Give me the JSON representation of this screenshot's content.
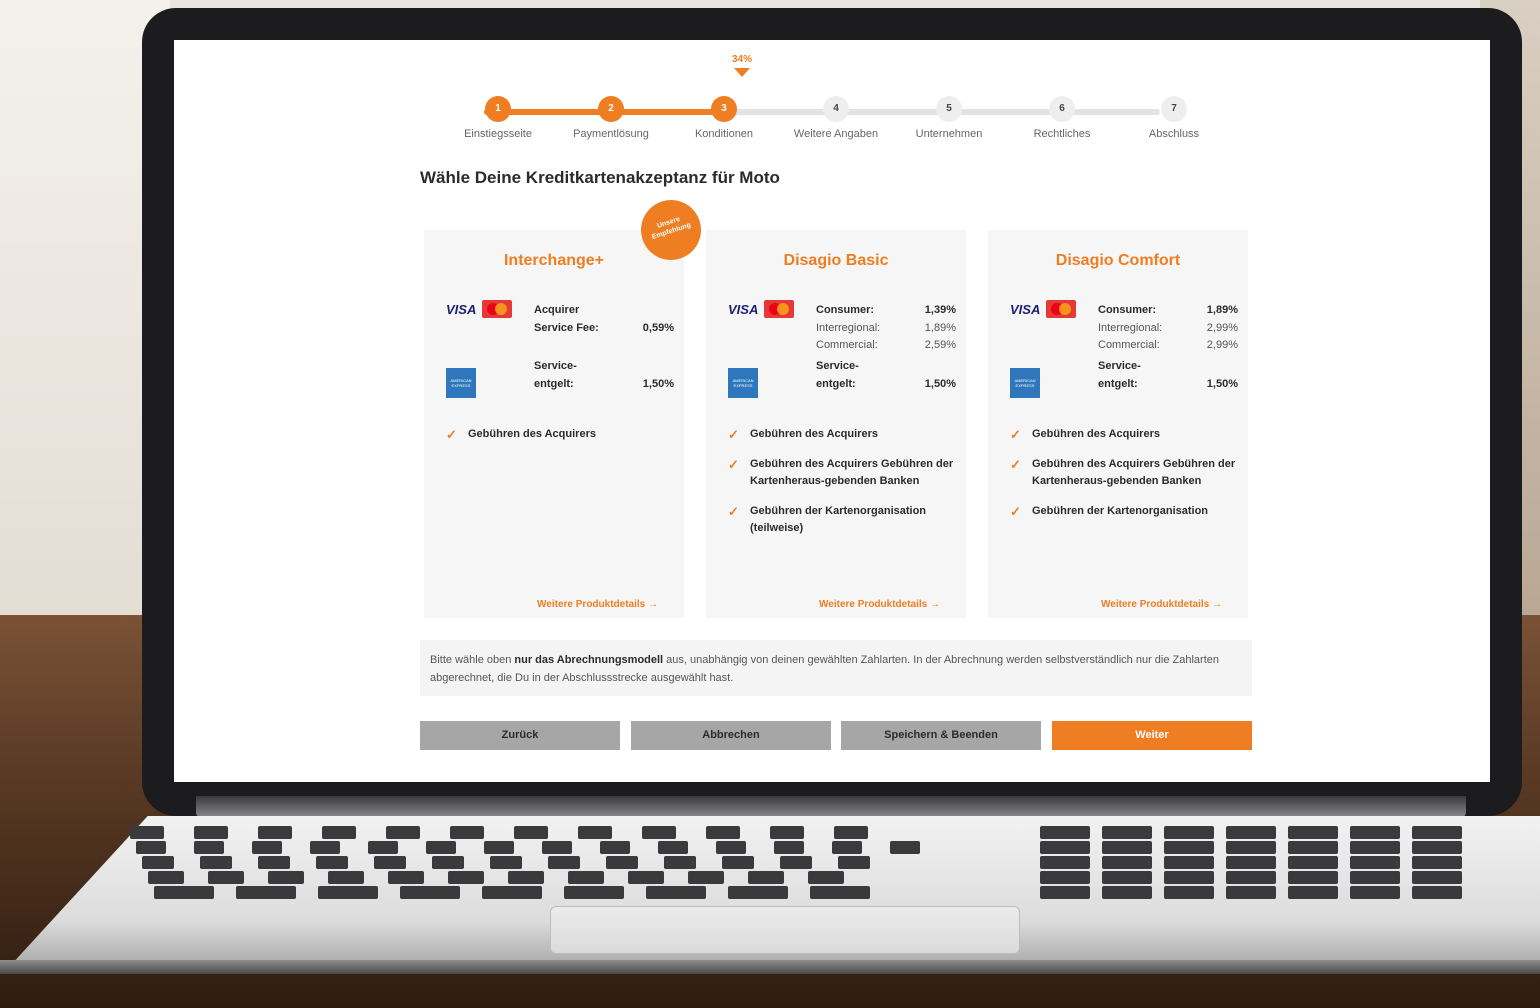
{
  "stepper": {
    "progress_label": "34%",
    "progress_fraction": 0.34,
    "steps": [
      {
        "number": "1",
        "label": "Einstiegsseite",
        "done": true
      },
      {
        "number": "2",
        "label": "Paymentlösung",
        "done": true
      },
      {
        "number": "3",
        "label": "Konditionen",
        "done": true
      },
      {
        "number": "4",
        "label": "Weitere Angaben",
        "done": false
      },
      {
        "number": "5",
        "label": "Unternehmen",
        "done": false
      },
      {
        "number": "6",
        "label": "Rechtliches",
        "done": false
      },
      {
        "number": "7",
        "label": "Abschluss",
        "done": false
      }
    ]
  },
  "page_title": "Wähle Deine Kreditkartenakzeptanz für Moto",
  "cards": [
    {
      "title": "Interchange+",
      "badge": "Unsere Empfehlung",
      "card_fees": {
        "acquirer_label_1": "Acquirer",
        "acquirer_label_2": "Service Fee:",
        "acquirer_value": "0,59%"
      },
      "amex": {
        "label_1": "Service-",
        "label_2": "entgelt:",
        "value": "1,50%"
      },
      "features": [
        "Gebühren des Acquirers"
      ],
      "details_link": "Weitere Produktdetails →"
    },
    {
      "title": "Disagio Basic",
      "card_fees": {
        "consumer_label": "Consumer:",
        "consumer_value": "1,39%",
        "interregional_label": "Interregional:",
        "interregional_value": "1,89%",
        "commercial_label": "Commercial:",
        "commercial_value": "2,59%"
      },
      "amex": {
        "label_1": "Service-",
        "label_2": "entgelt:",
        "value": "1,50%"
      },
      "features": [
        "Gebühren des Acquirers",
        "Gebühren des Acquirers Gebühren der Kartenheraus-gebenden Banken",
        "Gebühren der Kartenorganisation (teilweise)"
      ],
      "details_link": "Weitere Produktdetails →"
    },
    {
      "title": "Disagio Comfort",
      "card_fees": {
        "consumer_label": "Consumer:",
        "consumer_value": "1,89%",
        "interregional_label": "Interregional:",
        "interregional_value": "2,99%",
        "commercial_label": "Commercial:",
        "commercial_value": "2,99%"
      },
      "amex": {
        "label_1": "Service-",
        "label_2": "entgelt:",
        "value": "1,50%"
      },
      "features": [
        "Gebühren des Acquirers",
        "Gebühren des Acquirers Gebühren der Kartenheraus-gebenden Banken",
        "Gebühren der Kartenorganisation"
      ],
      "details_link": "Weitere Produktdetails →"
    }
  ],
  "logos": {
    "visa": "VISA",
    "amex": "AMERICAN EXPRESS"
  },
  "info": {
    "text_before": "Bitte wähle oben ",
    "text_bold": "nur das Abrechnungsmodell",
    "text_after": " aus, unabhängig von deinen gewählten Zahlarten. In der Abrechnung werden selbstverständlich nur die Zahlarten abgerechnet, die Du in der Abschlussstrecke ausgewählt hast."
  },
  "buttons": {
    "back": "Zurück",
    "cancel": "Abbrechen",
    "save_exit": "Speichern & Beenden",
    "next": "Weiter"
  },
  "colors": {
    "accent": "#ef7d22",
    "secondary_button": "#a6a6a6"
  }
}
